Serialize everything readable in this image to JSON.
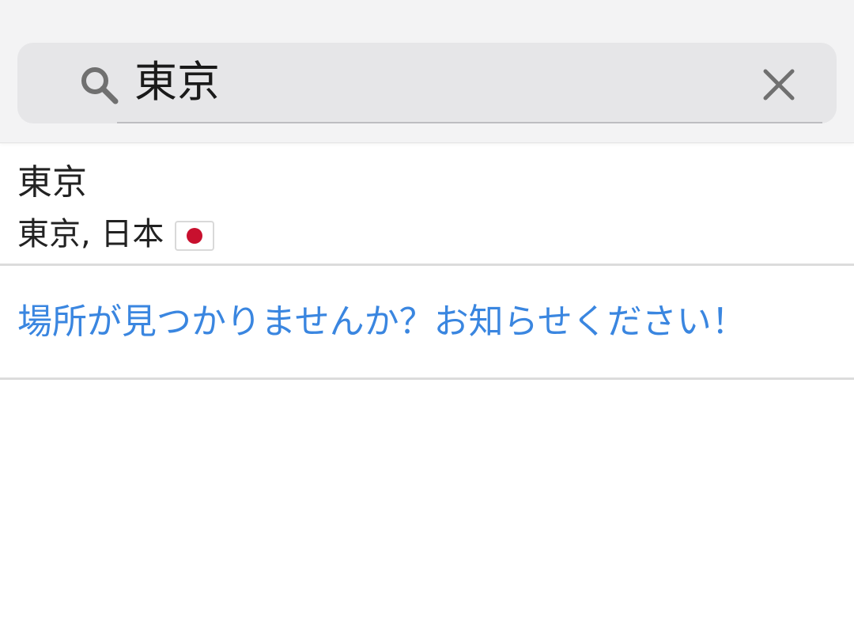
{
  "search": {
    "value": "東京",
    "search_icon": "search-icon",
    "clear_icon": "close-icon"
  },
  "results": [
    {
      "title": "東京",
      "subtitle": "東京, 日本",
      "flag_icon": "japan-flag-icon"
    }
  ],
  "report": {
    "label": "場所が見つかりませんか？お知らせください！"
  },
  "colors": {
    "link": "#3a86e0",
    "header_bg": "#f3f3f4",
    "search_bg": "#e6e6e8",
    "flag_red": "#c8102e"
  }
}
